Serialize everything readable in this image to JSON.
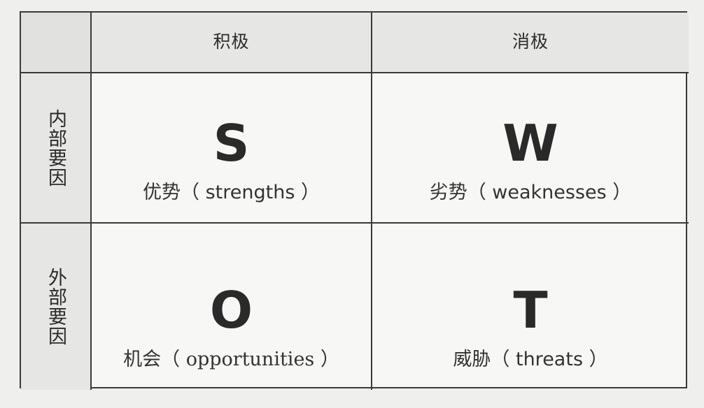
{
  "columns": {
    "positive": "积极",
    "negative": "消极"
  },
  "rows": {
    "internal": "内部要因",
    "external": "外部要因"
  },
  "quadrants": {
    "strengths": {
      "letter": "S",
      "label_cn": "优势",
      "label_en": "（ strengths ）"
    },
    "weaknesses": {
      "letter": "W",
      "label_cn": "劣势",
      "label_en": "（ weaknesses ）"
    },
    "opportunities": {
      "letter": "O",
      "label_cn": "机会",
      "label_en": "（ opportunities ）"
    },
    "threats": {
      "letter": "T",
      "label_cn": "威胁",
      "label_en": "（ threats ）"
    }
  }
}
